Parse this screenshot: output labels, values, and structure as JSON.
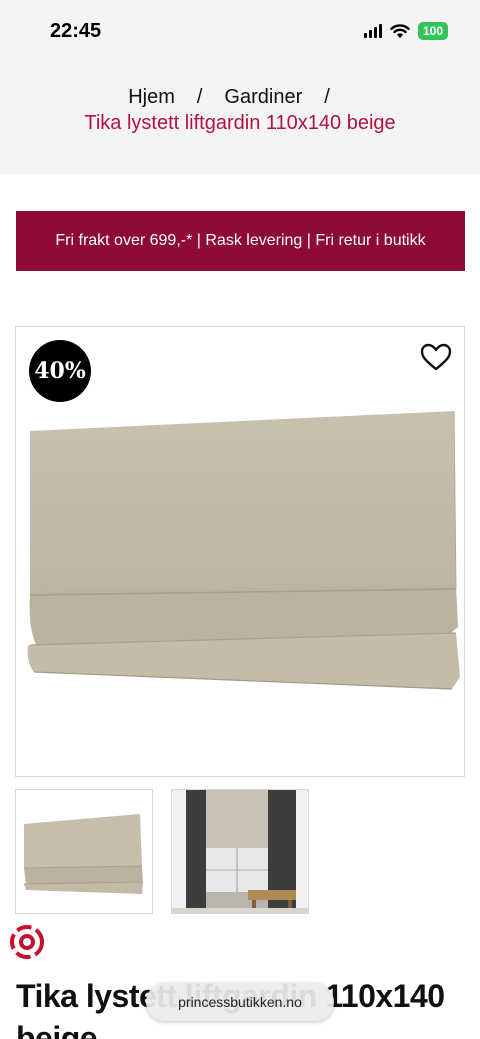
{
  "status_bar": {
    "time": "22:45",
    "battery": "100"
  },
  "breadcrumb": {
    "items": [
      "Hjem",
      "Gardiner"
    ],
    "separator": "/",
    "current": "Tika lystett liftgardin 110x140 beige"
  },
  "promo": {
    "text": "Fri frakt over 699,-* | Rask levering | Fri retur i butikk"
  },
  "product": {
    "discount": "40%",
    "title_lines": [
      "Tika lystett liftgardin 110x140",
      "beige"
    ]
  },
  "browser": {
    "url": "princessbutikken.no"
  },
  "colors": {
    "accent": "#8e0a36",
    "breadcrumb_current": "#b0143e",
    "fabric": "#c4bba9",
    "badge": "#000000"
  },
  "icons": [
    "signal-icon",
    "wifi-icon",
    "battery-icon",
    "heart-icon",
    "brand-logo-icon"
  ]
}
